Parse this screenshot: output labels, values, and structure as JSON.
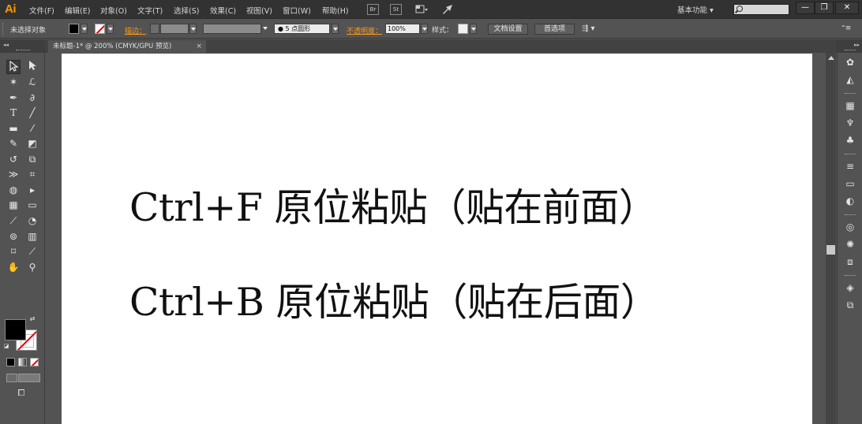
{
  "app": {
    "logo": "Ai"
  },
  "menubar": {
    "items": [
      "文件(F)",
      "编辑(E)",
      "对象(O)",
      "文字(T)",
      "选择(S)",
      "效果(C)",
      "视图(V)",
      "窗口(W)",
      "帮助(H)"
    ],
    "bridge_label": "Br",
    "stock_label": "St",
    "workspace_label": "基本功能 ▾",
    "window_buttons": {
      "minimize": "—",
      "restore": "❐",
      "close": "✕"
    }
  },
  "controlbar": {
    "selection_status": "未选择对象",
    "stroke_link": "描边：",
    "stroke_preset": "● 5 点圆形",
    "opacity_link": "不透明度：",
    "opacity_value": "100%",
    "style_label": "样式：",
    "doc_setup_button": "文档设置",
    "preferences_button": "首选项",
    "colors": {
      "fill": "#000000",
      "stroke_none_line": "#e20000",
      "link": "#ff9a1a"
    }
  },
  "document": {
    "tab_label": "未标题-1* @ 200% (CMYK/GPU 预览)",
    "tab_close": "×"
  },
  "artboard": {
    "lines": [
      "Ctrl+F   原位粘贴（贴在前面）",
      "Ctrl+B   原位粘贴（贴在后面）"
    ]
  },
  "toolbox": {
    "tools": [
      "selection-tool",
      "direct-selection-tool",
      "magic-wand-tool",
      "lasso-tool",
      "pen-tool",
      "curvature-tool",
      "type-tool",
      "line-segment-tool",
      "rectangle-tool",
      "paintbrush-tool",
      "pencil-tool",
      "eraser-tool",
      "rotate-tool",
      "scale-tool",
      "width-tool",
      "free-transform-tool",
      "shape-builder-tool",
      "perspective-grid-tool",
      "mesh-tool",
      "gradient-tool",
      "eyedropper-tool",
      "blend-tool",
      "symbol-sprayer-tool",
      "column-graph-tool",
      "artboard-tool",
      "slice-tool",
      "hand-tool",
      "zoom-tool"
    ],
    "fill_color": "#000000",
    "stroke_color": "none"
  },
  "right_dock": {
    "panels": [
      "color-guide-icon",
      "color-icon",
      "swatches-icon",
      "brushes-icon",
      "symbols-icon",
      "stroke-icon",
      "gradient-icon",
      "transparency-icon",
      "appearance-icon",
      "graphic-styles-icon",
      "asset-export-icon",
      "layers-icon",
      "artboards-icon"
    ]
  }
}
